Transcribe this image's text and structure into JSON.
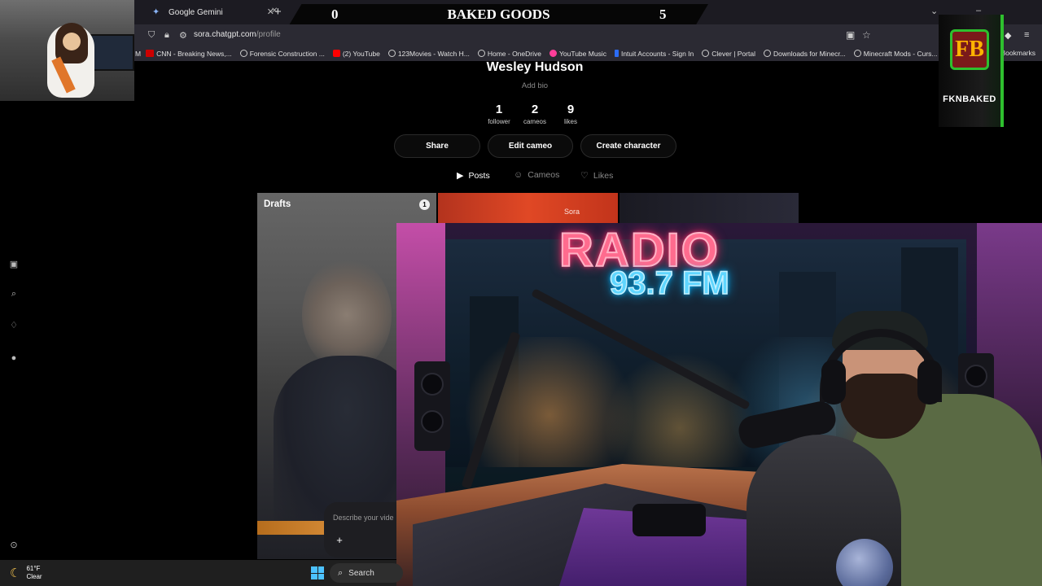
{
  "browser": {
    "tab_title": "Google Gemini",
    "new_tab": "+",
    "url_domain": "sora.chatgpt.com",
    "url_path": "/profile",
    "bookmarks": [
      {
        "label": "CNN - Breaking News,...",
        "icon": "cnn-icon"
      },
      {
        "label": "Forensic Construction ...",
        "icon": "globe-icon"
      },
      {
        "label": "(2) YouTube",
        "icon": "youtube-icon"
      },
      {
        "label": "123Movies - Watch H...",
        "icon": "globe-icon"
      },
      {
        "label": "Home - OneDrive",
        "icon": "globe-icon"
      },
      {
        "label": "YouTube Music",
        "icon": "youtube-music-icon"
      },
      {
        "label": "Intuit Accounts - Sign In",
        "icon": "intuit-icon"
      },
      {
        "label": "Clever | Portal",
        "icon": "globe-icon"
      },
      {
        "label": "Downloads for Minecr...",
        "icon": "globe-icon"
      },
      {
        "label": "Minecraft Mods - Curs...",
        "icon": "globe-icon"
      }
    ],
    "bookmarks_right": "Bookmarks"
  },
  "scoreboard": {
    "left": "0",
    "title": "BAKED GOODS",
    "right": "5"
  },
  "profile": {
    "name": "Wesley Hudson",
    "bio": "Add bio",
    "stats": [
      {
        "value": "1",
        "label": "follower"
      },
      {
        "value": "2",
        "label": "cameos"
      },
      {
        "value": "9",
        "label": "likes"
      }
    ],
    "buttons": {
      "share": "Share",
      "edit": "Edit cameo",
      "create": "Create character"
    },
    "tabs": {
      "posts": "Posts",
      "cameos": "Cameos",
      "likes": "Likes"
    }
  },
  "drafts": {
    "label": "Drafts",
    "count": "1"
  },
  "card2": {
    "watermark": "Sora"
  },
  "composer": {
    "placeholder": "Describe your vide",
    "plus": "+"
  },
  "logo": {
    "text": "FKNBAKED",
    "letters": "FB"
  },
  "studio": {
    "sign_top": "RADIO",
    "sign_bottom": "93.7 FM"
  },
  "taskbar": {
    "temp": "61°F",
    "condition": "Clear",
    "search": "Search"
  },
  "colors": {
    "accent_green": "#2ec02e",
    "neon_pink": "#ff6b8e",
    "neon_blue": "#5fd6ff"
  }
}
